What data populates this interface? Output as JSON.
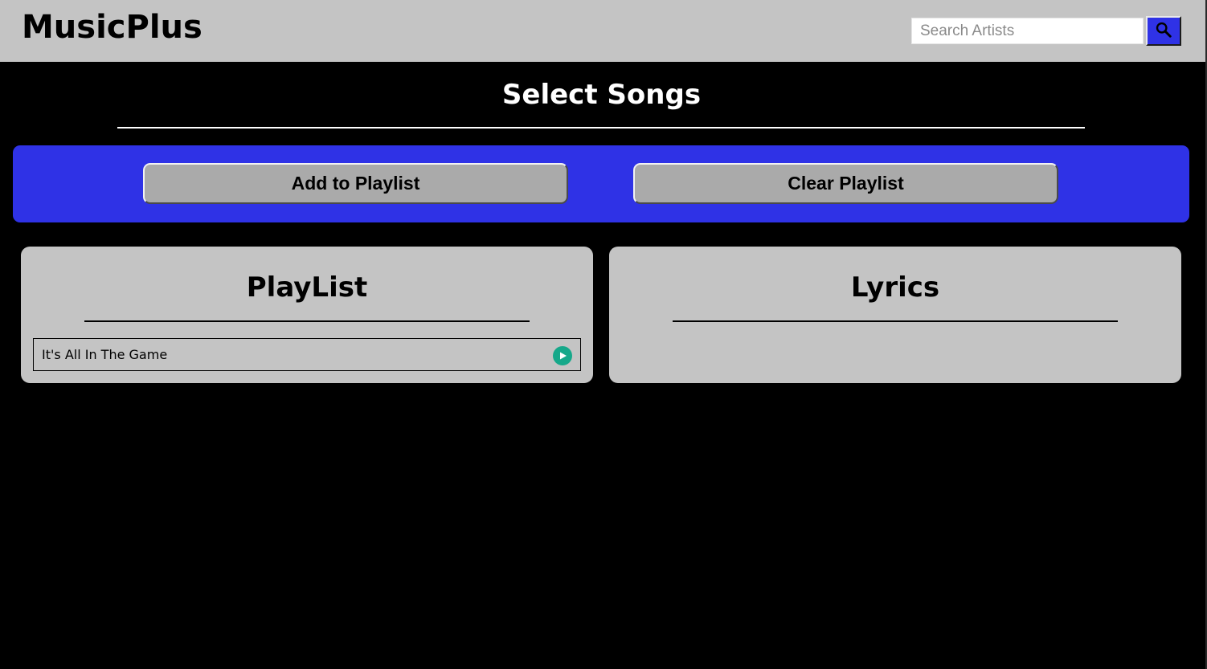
{
  "header": {
    "app_title": "MusicPlus",
    "search": {
      "placeholder": "Search Artists",
      "value": "",
      "button_icon": "search-icon"
    }
  },
  "main": {
    "section_title": "Select Songs",
    "actions": {
      "add_label": "Add to Playlist",
      "clear_label": "Clear Playlist"
    },
    "playlist": {
      "title": "PlayList",
      "songs": [
        {
          "title": "It's All In The Game",
          "action_icon": "play-icon"
        }
      ]
    },
    "lyrics": {
      "title": "Lyrics",
      "text": ""
    }
  },
  "colors": {
    "background": "#000000",
    "header": "#c4c4c4",
    "accent_blue": "#2f32e6",
    "panel": "#c4c4c4",
    "button": "#aaaaaa",
    "play_green": "#16a88a"
  }
}
